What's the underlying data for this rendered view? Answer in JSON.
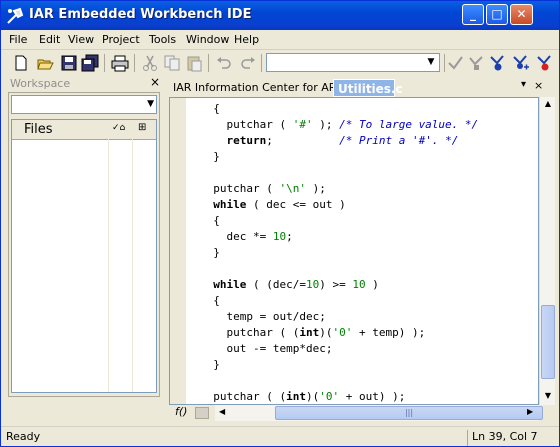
{
  "window": {
    "title": "IAR Embedded Workbench IDE"
  },
  "menu": [
    "File",
    "Edit",
    "View",
    "Project",
    "Tools",
    "Window",
    "Help"
  ],
  "toolbar": {
    "icons": [
      "new-file-icon",
      "open-folder-icon",
      "save-icon",
      "save-all-icon",
      "print-icon",
      "cut-icon",
      "copy-icon",
      "paste-icon",
      "undo-icon",
      "redo-icon",
      "find-combo",
      "check-icon",
      "make-icon",
      "debug-icon",
      "download-debug-icon",
      "breakpoint-icon"
    ],
    "combo_value": ""
  },
  "workspace": {
    "title": "Workspace",
    "close": "×",
    "combo_value": "",
    "files_header": "Files"
  },
  "tabs": [
    {
      "label": "IAR Information Center for ARM",
      "active": false
    },
    {
      "label": "Utilities.c",
      "active": true
    }
  ],
  "editor": {
    "lines": [
      "  {",
      "    putchar ( '#' ); /* To large value. */",
      "    return;          /* Print a '#'. */",
      "  }",
      "",
      "  putchar ( '\\n' );",
      "  while ( dec <= out )",
      "  {",
      "    dec *= 10;",
      "  }",
      "",
      "  while ( (dec/=10) >= 10 )",
      "  {",
      "    temp = out/dec;",
      "    putchar ( (int)('0' + temp) );",
      "    out -= temp*dec;",
      "  }",
      "",
      "  putchar ( (int)('0' + out) );"
    ]
  },
  "hbar": {
    "fo_label": "f()"
  },
  "status": {
    "left": "Ready",
    "position": "Ln 39, Col 7"
  }
}
